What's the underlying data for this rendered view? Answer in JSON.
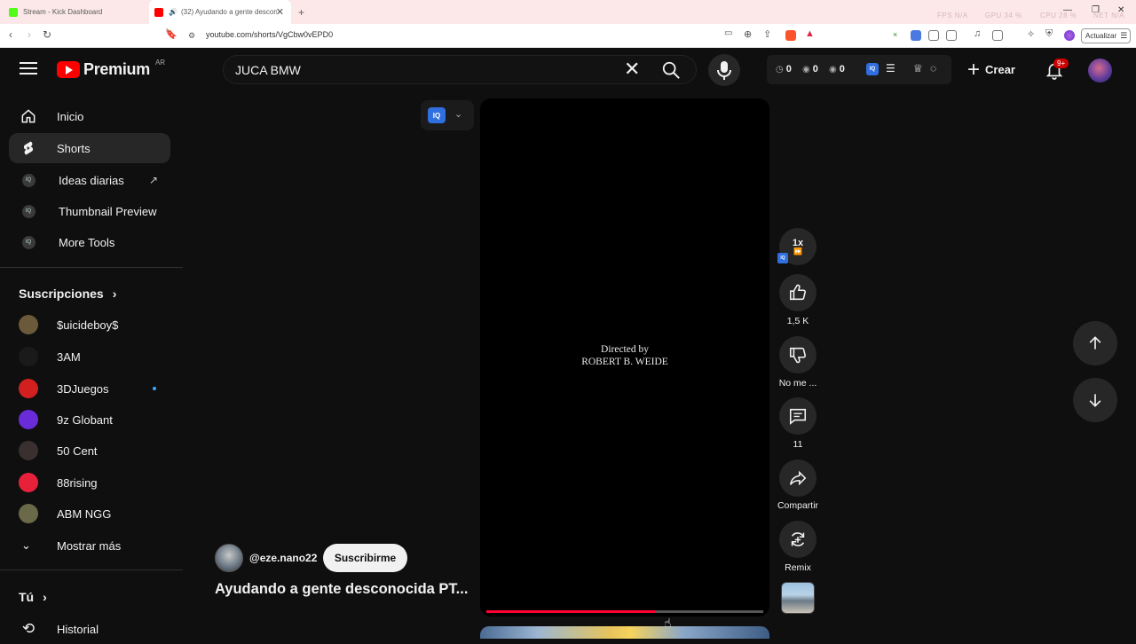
{
  "browser": {
    "tabs": [
      {
        "title": "Stream - Kick Dashboard",
        "favicon_color": "#53fc18"
      },
      {
        "title": "(32) Ayudando a gente descon",
        "favicon_color": "#ff0000"
      }
    ],
    "new_tab": "+",
    "perf": {
      "fps": "FPS N/A",
      "gpu": "GPU 34 %",
      "cpu": "CPU 28 %",
      "net": "NET N/A"
    },
    "url": "youtube.com/shorts/VgCbw0vEPD0",
    "update_label": "Actualizar",
    "colors": {
      "tabbar": "#fce8e8",
      "brave": "#fb542b"
    }
  },
  "header": {
    "logo_word": "Premium",
    "country": "AR",
    "search_value": "JUCA BMW",
    "stats": [
      {
        "icon": "clock-icon",
        "value": "0"
      },
      {
        "icon": "eye-off-icon",
        "value": "0"
      },
      {
        "icon": "eye-icon",
        "value": "0"
      }
    ],
    "create_label": "Crear",
    "notif_count": "9+"
  },
  "sidebar": {
    "primary": [
      {
        "label": "Inicio",
        "icon": "home-icon"
      },
      {
        "label": "Shorts",
        "icon": "shorts-icon",
        "active": true
      },
      {
        "label": "Ideas diarias",
        "icon": "iq-icon"
      },
      {
        "label": "Thumbnail Preview",
        "icon": "iq-icon"
      },
      {
        "label": "More Tools",
        "icon": "iq-icon"
      }
    ],
    "subs_title": "Suscripciones",
    "subs": [
      {
        "name": "$uicideboy$",
        "color": "#6a5a3a"
      },
      {
        "name": "3AM",
        "color": "#1a1a1a"
      },
      {
        "name": "3DJuegos",
        "color": "#d21f1f"
      },
      {
        "name": "9z Globant",
        "color": "#6a2bd9"
      },
      {
        "name": "50 Cent",
        "color": "#3a3030"
      },
      {
        "name": "88rising",
        "color": "#e8213b"
      },
      {
        "name": "ABM NGG",
        "color": "#6a6a4a"
      }
    ],
    "show_more": "Mostrar más",
    "you_title": "Tú",
    "history": "Historial"
  },
  "player": {
    "credit_line1": "Directed by",
    "credit_line2": "ROBERT B. WEIDE",
    "progress": 0.61
  },
  "video": {
    "channel": "@eze.nano22",
    "subscribe_label": "Suscribirme",
    "title": "Ayudando a gente desconocida PT..."
  },
  "actions": {
    "speed": "1x",
    "likes": "1,5 K",
    "dislike_label": "No me ...",
    "comments": "11",
    "share_label": "Compartir",
    "remix_label": "Remix"
  }
}
